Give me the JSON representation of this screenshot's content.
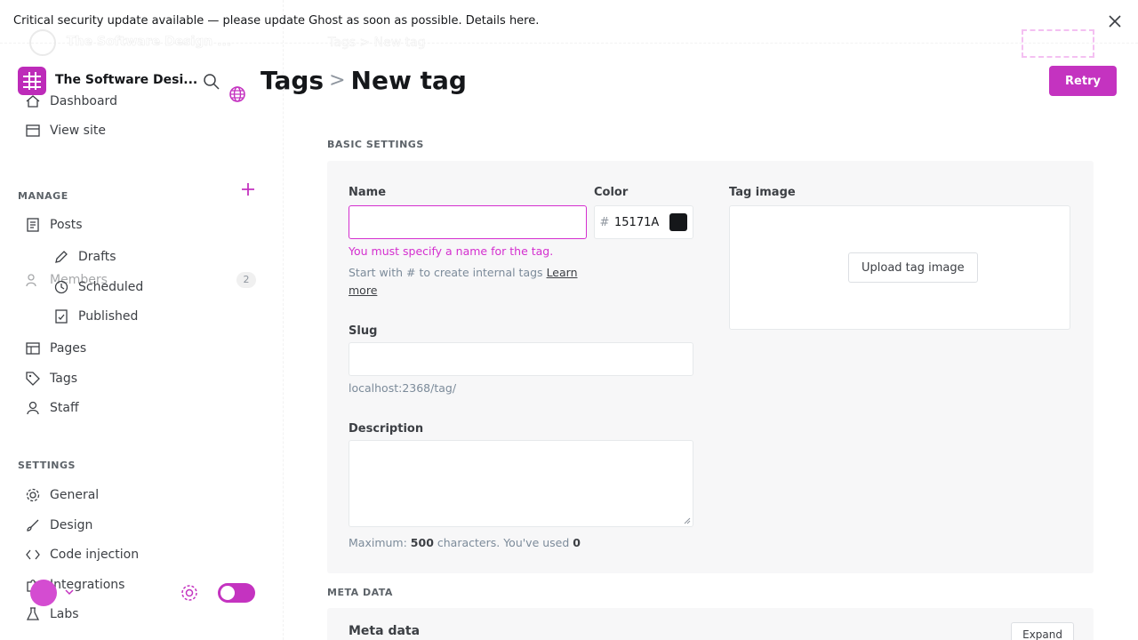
{
  "banner": {
    "text": "Critical security update available — please update Ghost as soon as possible. Details here."
  },
  "ghost": {
    "brand": "The Software Design ...",
    "breadcrumb": "Tags  >  New tag"
  },
  "sidebar": {
    "brand": "The Software Desi...",
    "nav_top": [
      {
        "label": "Dashboard",
        "icon": "home-icon"
      },
      {
        "label": "View site",
        "icon": "browser-icon"
      }
    ],
    "manage_label": "MANAGE",
    "posts_label": "Posts",
    "post_subs": [
      {
        "label": "Drafts",
        "icon": "pencil-icon"
      },
      {
        "label": "Scheduled",
        "icon": "clock-icon"
      },
      {
        "label": "Published",
        "icon": "published-icon"
      }
    ],
    "pages_label": "Pages",
    "tags_label": "Tags",
    "members_label": "Members",
    "members_count": "2",
    "staff_label": "Staff",
    "settings_label": "SETTINGS",
    "settings_items": [
      {
        "label": "General",
        "icon": "gear-icon"
      },
      {
        "label": "Design",
        "icon": "brush-icon"
      },
      {
        "label": "Code injection",
        "icon": "code-icon"
      },
      {
        "label": "Integrations",
        "icon": "puzzle-icon"
      },
      {
        "label": "Labs",
        "icon": "flask-icon"
      }
    ]
  },
  "main": {
    "title_parent": "Tags",
    "title_sep": ">",
    "title_current": "New tag",
    "save_label": "Retry",
    "basic_label": "BASIC SETTINGS",
    "name_label": "Name",
    "name_value": "",
    "name_error": "You must specify a name for the tag.",
    "name_hint": "Start with # to create internal tags",
    "name_hint_link": "Learn more",
    "color_label": "Color",
    "color_value": "15171A",
    "tag_image_label": "Tag image",
    "upload_label": "Upload tag image",
    "slug_label": "Slug",
    "slug_url": "localhost:2368/tag/",
    "description_label": "Description",
    "description_hint_prefix": "Maximum:",
    "description_max": "500",
    "description_hint_mid": "characters. You've used",
    "description_used": "0",
    "meta_label": "META DATA",
    "meta_title": "Meta data",
    "expand_label": "Expand"
  }
}
